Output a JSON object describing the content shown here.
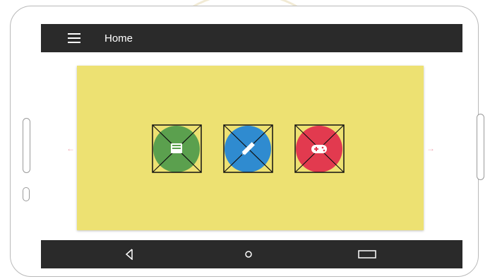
{
  "app": {
    "title": "Home"
  },
  "buttons": [
    {
      "name": "book",
      "icon": "book-icon",
      "color": "#5ba04e"
    },
    {
      "name": "edit",
      "icon": "pencil-icon",
      "color": "#2f8bd0"
    },
    {
      "name": "game",
      "icon": "gamepad-icon",
      "color": "#e23a4f"
    }
  ],
  "nav": {
    "back": "back-icon",
    "home": "home-icon",
    "recents": "recents-icon"
  },
  "colors": {
    "appbar": "#2a2a2a",
    "card": "#ede172",
    "arrow": "#f0a9b4"
  }
}
